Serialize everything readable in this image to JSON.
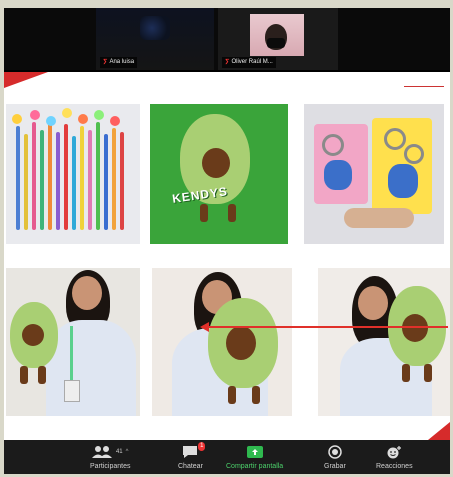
{
  "participants_strip": {
    "tiles": [
      {
        "name": "Ana luisa"
      },
      {
        "name": "Oliver Raúl M..."
      }
    ]
  },
  "toolbar": {
    "participants_label": "Participantes",
    "participants_count": "41",
    "chat_label": "Chatear",
    "chat_badge": "1",
    "share_label": "Compartir pantalla",
    "record_label": "Grabar",
    "reactions_label": "Reacciones",
    "caret": "^"
  },
  "slide": {
    "photo_text": "KENDYS"
  },
  "colors": {
    "accent_red": "#d62b2b",
    "share_green": "#4cd06b",
    "toolbar_bg": "#1b1b1b"
  }
}
